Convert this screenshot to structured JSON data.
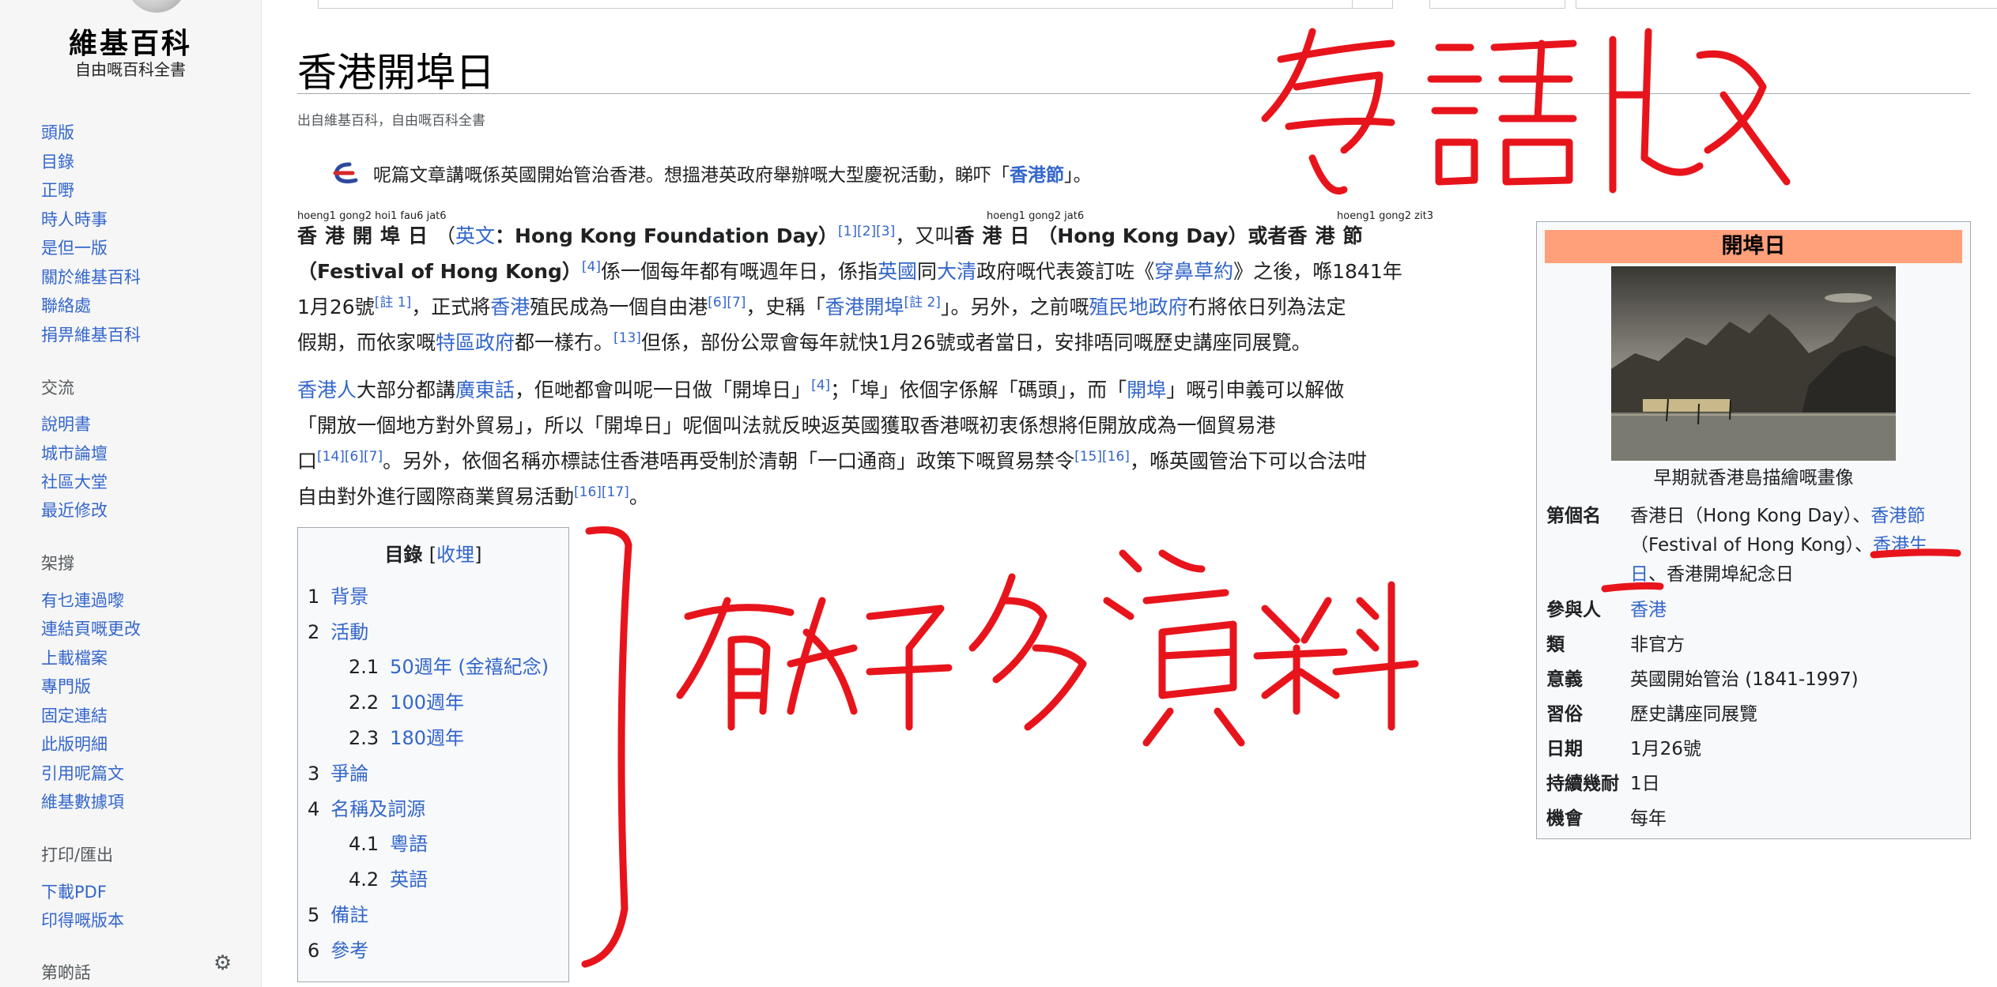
{
  "logo": {
    "title": "維基百科",
    "subtitle": "自由嘅百科全書"
  },
  "sidebar": {
    "nav": [
      "頭版",
      "目錄",
      "正嘢",
      "時人時事",
      "是但一版",
      "關於維基百科",
      "聯絡處",
      "捐畀維基百科"
    ],
    "interaction_heading": "交流",
    "interaction": [
      "說明書",
      "城市論壇",
      "社區大堂",
      "最近修改"
    ],
    "tools_heading": "架撐",
    "tools": [
      "有乜連過嚟",
      "連結頁嘅更改",
      "上載檔案",
      "專門版",
      "固定連結",
      "此版明細",
      "引用呢篇文",
      "維基數據項"
    ],
    "print_heading": "打印/匯出",
    "print": [
      "下載PDF",
      "印得嘅版本"
    ],
    "languages_heading": "第啲話"
  },
  "article": {
    "title": "香港開埠日",
    "from": "出自維基百科，自由嘅百科全書",
    "hatnote": {
      "text": "呢篇文章講嘅係英國開始管治香港。想搵港英政府舉辦嘅大型慶祝活動，睇吓「",
      "link": "香港節",
      "end": "」。"
    },
    "ruby": [
      "hoeng1 gong2 hoi1 fau6 jat6",
      "hoeng1 gong2 jat6",
      "hoeng1 gong2 zit3"
    ],
    "p1_l1": {
      "a": "香港開埠日",
      "b": "（",
      "c": "英文",
      "d": "：Hong Kong Foundation Day）",
      "e": "[1][2][3]",
      "f": "，又叫",
      "g": "香港日",
      "h": "（Hong Kong Day）或者",
      "i": "香港節"
    },
    "p1_l2": {
      "a": "（Festival of Hong Kong）",
      "b": "[4]",
      "c": "係一個每年都有嘅週年日，係指",
      "d": "英國",
      "e": "同",
      "f": "大清",
      "g": "政府嘅代表簽訂咗《",
      "h": "穿鼻草約",
      "i": "》之後，喺1841年"
    },
    "p1_l3": {
      "a": "1月26號",
      "b": "[註 1]",
      "c": "，正式將",
      "d": "香港",
      "e": "殖民成為一個自由港",
      "f": "[6][7]",
      "g": "，史稱「",
      "h": "香港開埠",
      "i": "[註 2]",
      "j": "」。另外，之前嘅",
      "k": "殖民地政府",
      "l": "冇將依日列為法定"
    },
    "p1_l4": {
      "a": "假期，而依家嘅",
      "b": "特區政府",
      "c": "都一樣冇。",
      "d": "[13]",
      "e": "但係，部份公眾會每年就快1月26號或者當日，安排唔同嘅歷史講座同展覽。"
    },
    "p2_l1": {
      "a": "香港人",
      "b": "大部分都講",
      "c": "廣東話",
      "d": "，佢哋都會叫呢一日做「開埠日」",
      "e": "[4]",
      "f": "；「埠」依個字係解「碼頭」，而「",
      "g": "開埠",
      "h": "」嘅引申義可以解做"
    },
    "p2_l2": "「開放一個地方對外貿易」，所以「開埠日」呢個叫法就反映返英國獲取香港嘅初衷係想將佢開放成為一個貿易港",
    "p2_l3": {
      "a": "口",
      "b": "[14][6][7]",
      "c": "。另外，依個名稱亦標誌住香港唔再受制於清朝「一口通商」政策下嘅貿易禁令",
      "d": "[15][16]",
      "e": "，喺英國管治下可以合法咁"
    },
    "p2_l4": {
      "a": "自由對外進行國際商業貿易活動",
      "b": "[16][17]",
      "c": "。"
    }
  },
  "toc": {
    "title": "目錄",
    "toggle_open": "[",
    "toggle": "收埋",
    "toggle_close": "]",
    "items": [
      {
        "num": "1",
        "label": "背景"
      },
      {
        "num": "2",
        "label": "活動"
      },
      {
        "num": "2.1",
        "label": "50週年 (金禧紀念)"
      },
      {
        "num": "2.2",
        "label": "100週年"
      },
      {
        "num": "2.3",
        "label": "180週年"
      },
      {
        "num": "3",
        "label": "爭論"
      },
      {
        "num": "4",
        "label": "名稱及詞源"
      },
      {
        "num": "4.1",
        "label": "粵語"
      },
      {
        "num": "4.2",
        "label": "英語"
      },
      {
        "num": "5",
        "label": "備註"
      },
      {
        "num": "6",
        "label": "參考"
      }
    ]
  },
  "infobox": {
    "title": "開埠日",
    "caption": "早期就香港島描繪嘅畫像",
    "rows": [
      {
        "label": "第個名",
        "l1a": "香港日（Hong Kong Day）、",
        "l1b": "香港節",
        "l2a": "（Festival of Hong Kong）、",
        "l2b": "香港生",
        "l3a": "日",
        "l3b": "、香港開埠紀念日"
      },
      {
        "label": "參與人",
        "value": "香港"
      },
      {
        "label": "類",
        "value": "非官方"
      },
      {
        "label": "意義",
        "value": "英國開始管治 (1841-1997)"
      },
      {
        "label": "習俗",
        "value": "歷史講座同展覽"
      },
      {
        "label": "日期",
        "value": "1月26號"
      },
      {
        "label": "持續幾耐",
        "value": "1日"
      },
      {
        "label": "機會",
        "value": "每年"
      }
    ]
  },
  "colors": {
    "link": "#3366cc",
    "infobox_header": "#ffa07a",
    "annotation": "#e8141c"
  }
}
